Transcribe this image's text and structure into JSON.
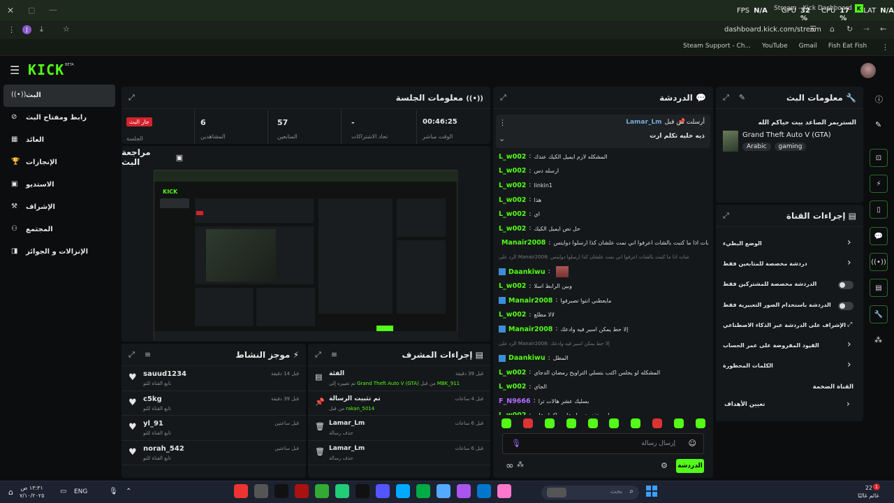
{
  "browser": {
    "tab_title": "Stream - Kick Dashboard",
    "perf": {
      "fps_label": "FPS",
      "fps": "N/A",
      "gpu_label": "GPU",
      "gpu": "32 %",
      "cpu_label": "CPU",
      "cpu": "17 %",
      "lat_label": "LAT",
      "lat": "N/A"
    },
    "url": "dashboard.kick.com/stream",
    "bookmarks": [
      "Steam Support - Ch...",
      "YouTube",
      "Gmail",
      "Fish Eat Fish"
    ]
  },
  "header": {
    "logo": "KICK",
    "beta": "BETA"
  },
  "sidebar": {
    "items": [
      {
        "label": "البث",
        "icon": "((•))"
      },
      {
        "label": "رابط ومفتاح البث",
        "icon": "⊘"
      },
      {
        "label": "العائد",
        "icon": "▦"
      },
      {
        "label": "الإنجازات",
        "icon": "🏆"
      },
      {
        "label": "الاستديو",
        "icon": "▣"
      },
      {
        "label": "الإشراف",
        "icon": "⚒"
      },
      {
        "label": "المجتمع",
        "icon": "⚇"
      },
      {
        "label": "الإنزالات و الجوائز",
        "icon": "◨"
      }
    ]
  },
  "session": {
    "title": "معلومات الجلسة",
    "status_badge": "جار البث",
    "session_label": "الجلسة",
    "viewers": "6",
    "viewers_label": "المشاهدين",
    "followers": "57",
    "followers_label": "المتابعين",
    "subs": "-",
    "subs_label": "تحاد الاشتراكات",
    "uptime": "00:46:25",
    "uptime_label": "الوقت مباشر"
  },
  "preview": {
    "title": "مراجعة البث"
  },
  "activity": {
    "title": "موجز النشاط",
    "items": [
      {
        "name": "sauud1234",
        "sub": "تابع القناة للتو",
        "time": "قبل 14 دقيقة"
      },
      {
        "name": "c5kg",
        "sub": "تابع القناة للتو",
        "time": "قبل 39 دقيقة"
      },
      {
        "name": "yl_91",
        "sub": "تابع القناة للتو",
        "time": "قبل ساعتين"
      },
      {
        "name": "norah_542",
        "sub": "تابع القناة للتو",
        "time": "قبل ساعتين"
      }
    ]
  },
  "modactions": {
    "title": "إجراءات المشرف",
    "items": [
      {
        "name": "الفئة",
        "sub_a": "تم تغييره إلى ",
        "sub_g1": "Grand Theft Auto V (GTA)",
        "sub_b": " من قبل ",
        "sub_g2": "MBK_911",
        "time": "قبل 39 دقيقة",
        "icon": "▤"
      },
      {
        "name": "تم تثبيت الرسالة",
        "sub_a": "من قبل ",
        "sub_g1": "rakan_5014",
        "sub_b": "",
        "sub_g2": "",
        "time": "قبل 4 ساعات",
        "icon": "📌"
      },
      {
        "name": "Lamar_Lm",
        "sub_a": "حذف رسالة",
        "sub_g1": "",
        "sub_b": "",
        "sub_g2": "",
        "time": "قبل 6 ساعات",
        "icon": "🗑"
      },
      {
        "name": "Lamar_Lm",
        "sub_a": "حذف رسالة",
        "sub_g1": "",
        "sub_b": "",
        "sub_g2": "",
        "time": "قبل 6 ساعات",
        "icon": "🗑"
      }
    ]
  },
  "chat": {
    "title": "الدردشة",
    "pinned": {
      "by": "أرسلت من قبل",
      "user": "Lamar_Lm",
      "text": "ذيه خليه تكلم ارت"
    },
    "lines": [
      {
        "user": "L_w002",
        "text": "المشكله لازم ايميل الكيك عندك",
        "color": "#53fc18"
      },
      {
        "user": "L_w002",
        "text": "ارسله دس",
        "color": "#53fc18"
      },
      {
        "user": "L_w002",
        "text": "linkin1",
        "color": "#53fc18"
      },
      {
        "user": "L_w002",
        "text": "هذا",
        "color": "#53fc18"
      },
      {
        "user": "L_w002",
        "text": "اي",
        "color": "#53fc18"
      },
      {
        "user": "L_w002",
        "text": "حل نص ايميل الكيك",
        "color": "#53fc18"
      },
      {
        "user": "Manair2008",
        "text": "شات اذا ما كتبت بالشات اعرفوا اني نمت علشان كذا ارسلوا دوايتس 😊",
        "color": "#53fc18"
      },
      {
        "user": "",
        "text": "الرد على Manair2008: شات اذا ما كتبت بالشات اعرفوا اني نمت علشان كذا ارسلوا دوايتس",
        "color": "#777"
      },
      {
        "user": "Daankiwu",
        "text": "",
        "color": "#53fc18"
      },
      {
        "user": "L_w002",
        "text": "وبين الرابط اسلا",
        "color": "#53fc18"
      },
      {
        "user": "Manair2008",
        "text": "مايعطني انتوا تصبرفوا",
        "color": "#53fc18"
      },
      {
        "user": "L_w002",
        "text": "لالا مطلع",
        "color": "#53fc18"
      },
      {
        "user": "Manair2008",
        "text": "إلا حط يمكن اسير فيه وادعك",
        "color": "#53fc18"
      },
      {
        "user": "",
        "text": "الرد على Manair2008: إلا حط يمكن اسير فيه وادعك",
        "color": "#777"
      },
      {
        "user": "Daankiwu",
        "text": "المطل",
        "color": "#53fc18"
      },
      {
        "user": "L_w002",
        "text": "المشكله لو يجلس اكتب بتسلي التراويح رمضان الدجاي",
        "color": "#53fc18"
      },
      {
        "user": "L_w002",
        "text": "الجاي",
        "color": "#53fc18"
      },
      {
        "user": "F_N9666",
        "text": "بسليك عشر هالات ترا",
        "color": "#b06cff"
      },
      {
        "user": "L_w002",
        "text": "طيب تقدر ترسل علي واكمل عليه",
        "color": "#53fc18"
      }
    ],
    "input_placeholder": "إرسال رسالة",
    "send_label": "الدردشة"
  },
  "streaminfo": {
    "title": "معلومات البث",
    "stream_title": "الستريمر الصاعد بيت حياكم الله",
    "category": "Grand Theft Auto V (GTA)",
    "tags": [
      "Arabic",
      "gaming"
    ]
  },
  "channel": {
    "title": "إجراءات القناة",
    "items": [
      {
        "label": "الوضع البطيء",
        "type": "arrow"
      },
      {
        "label": "دردشة مخصصة للمتابعين فقط",
        "type": "arrow"
      },
      {
        "label": "الدردشة مخصصة للمشتركين فقط",
        "type": "toggle"
      },
      {
        "label": "الدردشة باستخدام الصور التعبيرية فقط",
        "type": "toggle"
      },
      {
        "label": "الإشراف على الدردشة عبر الذكاء الاصطناعي",
        "type": "ext"
      },
      {
        "label": "القيود المفروضة على عمر الحساب",
        "type": "arrow"
      },
      {
        "label": "الكلمات المحظورة",
        "type": "arrow"
      }
    ],
    "section": "القناة الضخمة",
    "goals": "تعيين الأهداف"
  },
  "taskbar": {
    "time": "١٣:٣١ ص",
    "date": "٧/١٠/٢٠٢٥",
    "lang": "ENG",
    "search": "بحث",
    "temp": "22°C",
    "weather": "غائم غالبًا",
    "notif": "1"
  },
  "colors": {
    "accent": "#53fc18",
    "bg": "#0b0d0e",
    "panel": "#15181a",
    "live": "#d3232c"
  }
}
